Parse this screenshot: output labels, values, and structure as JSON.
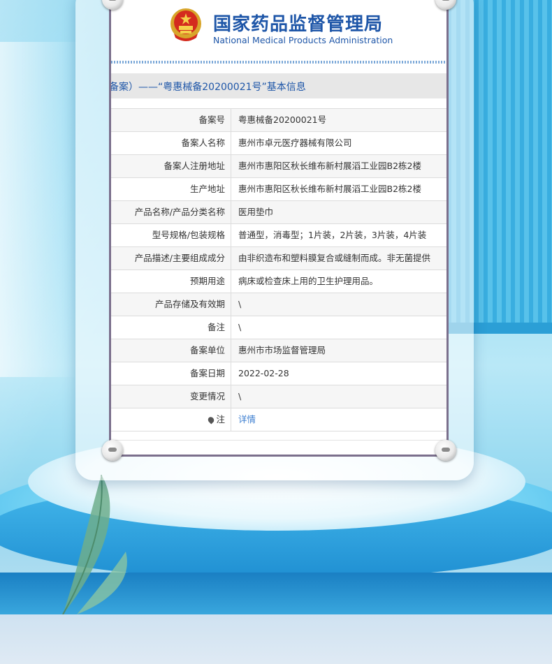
{
  "header": {
    "title_cn": "国家药品监督管理局",
    "title_en": "National Medical Products Administration"
  },
  "record_title": "备案）——“粤惠械备20200021号”基本信息",
  "rows": [
    {
      "label": "备案号",
      "value": "粤惠械备20200021号"
    },
    {
      "label": "备案人名称",
      "value": "惠州市卓元医疗器械有限公司"
    },
    {
      "label": "备案人注册地址",
      "value": "惠州市惠阳区秋长维布新村展滔工业园B2栋2楼"
    },
    {
      "label": "生产地址",
      "value": "惠州市惠阳区秋长维布新村展滔工业园B2栋2楼"
    },
    {
      "label": "产品名称/产品分类名称",
      "value": "医用垫巾"
    },
    {
      "label": "型号规格/包装规格",
      "value": "普通型，消毒型；1片装，2片装，3片装，4片装"
    },
    {
      "label": "产品描述/主要组成成分",
      "value": "由非织造布和塑料膜复合或缝制而成。非无菌提供"
    },
    {
      "label": "预期用途",
      "value": "病床或检查床上用的卫生护理用品。"
    },
    {
      "label": "产品存储及有效期",
      "value": "\\"
    },
    {
      "label": "备注",
      "value": "\\"
    },
    {
      "label": "备案单位",
      "value": "惠州市市场监督管理局"
    },
    {
      "label": "备案日期",
      "value": "2022-02-28"
    },
    {
      "label": "变更情况",
      "value": "\\"
    }
  ],
  "note_row": {
    "label": "注",
    "value": "详情"
  },
  "icons": {
    "emblem": "national-emblem-icon",
    "note": "pin-icon"
  },
  "colors": {
    "brand_blue": "#1e56a8",
    "link_blue": "#3b7ed0",
    "frame_border": "#7b6f8c"
  }
}
